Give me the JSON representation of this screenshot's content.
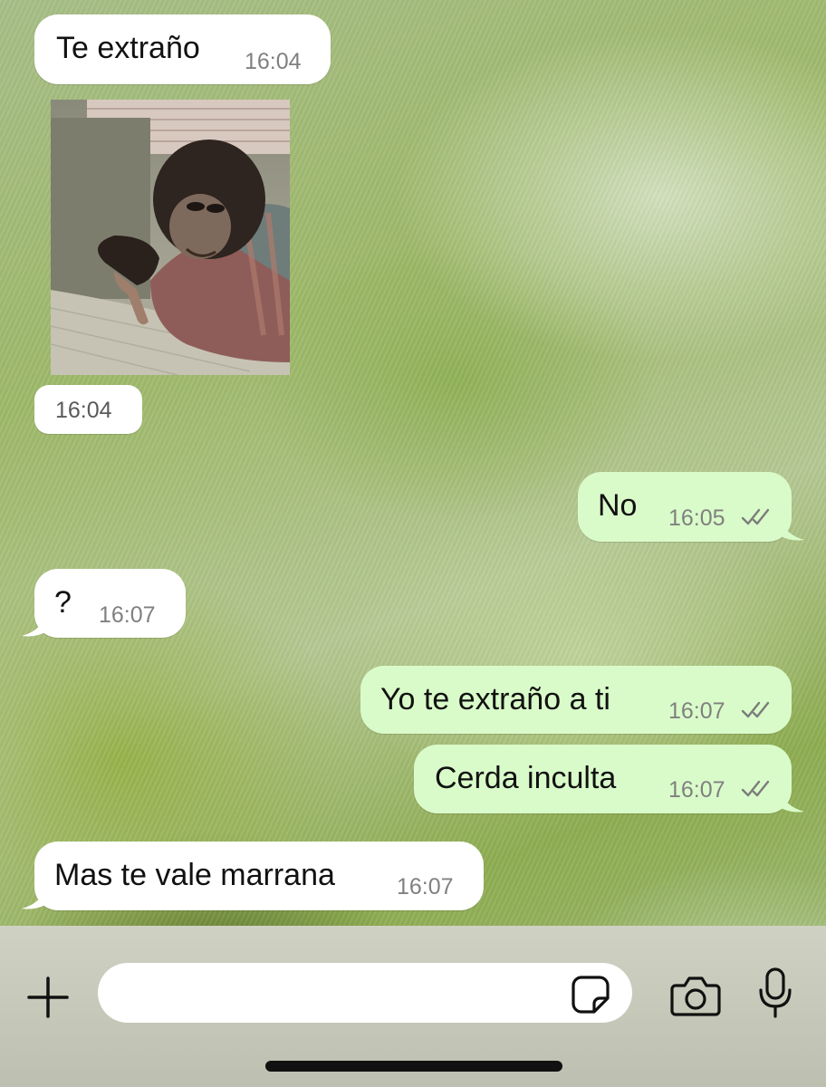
{
  "chat": {
    "messages": [
      {
        "direction": "incoming",
        "text": "Te extraño",
        "time": "16:04"
      },
      {
        "direction": "incoming",
        "type": "image",
        "image": "sticker-chimp-pointing-down",
        "time": "16:04"
      },
      {
        "direction": "outgoing",
        "text": "No",
        "time": "16:05",
        "status": "read-double-check"
      },
      {
        "direction": "incoming",
        "text": "?",
        "time": "16:07"
      },
      {
        "direction": "outgoing",
        "text": "Yo te extraño a ti",
        "time": "16:07",
        "status": "read-double-check"
      },
      {
        "direction": "outgoing",
        "text": "Cerda inculta",
        "time": "16:07",
        "status": "read-double-check"
      },
      {
        "direction": "incoming",
        "text": "Mas te vale marrana",
        "time": "16:07"
      }
    ]
  },
  "composer": {
    "placeholder": "",
    "icons": [
      "plus-icon",
      "sticker-icon",
      "camera-icon",
      "microphone-icon"
    ]
  },
  "colors": {
    "incoming_bubble": "#ffffff",
    "outgoing_bubble": "#d9fbc9",
    "timestamp": "#808080",
    "composer_bar": "#c8cabb"
  }
}
